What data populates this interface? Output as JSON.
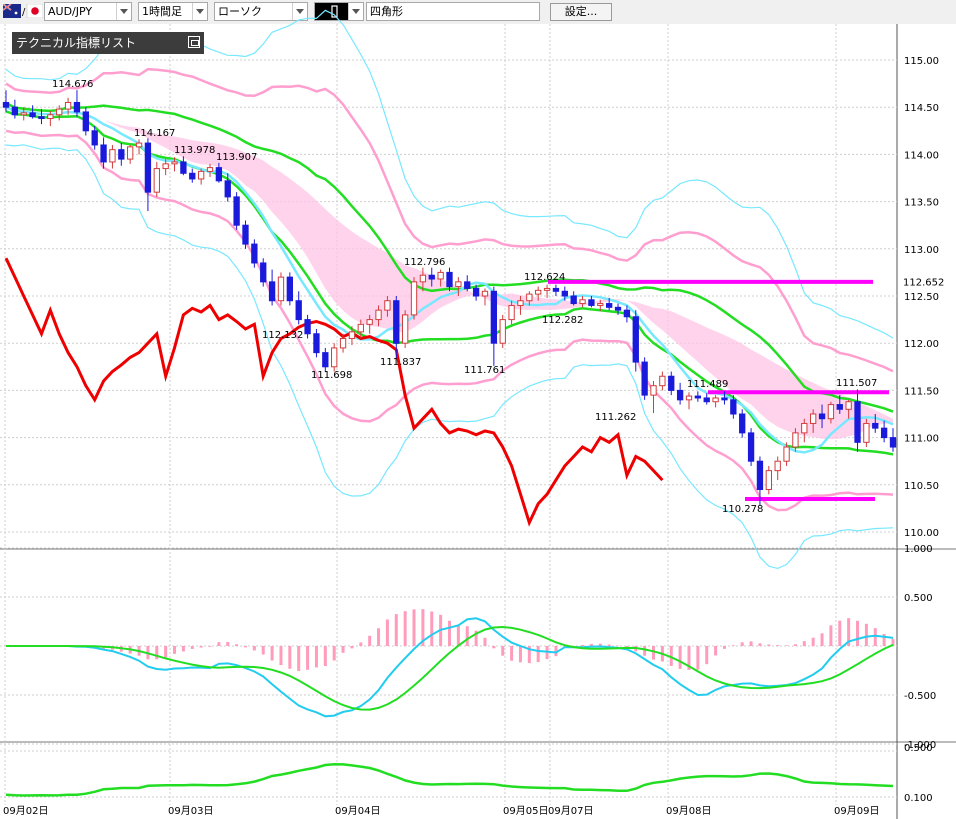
{
  "toolbar": {
    "pair": "AUD/JPY",
    "timeframe": "1時間足",
    "chart_style": "ローソク",
    "draw_tool": "四角形",
    "settings_label": "設定..."
  },
  "indicator_panel": {
    "title": "テクニカル指標リスト"
  },
  "colors": {
    "bull": "#d23c3c",
    "bear": "#1a1adc",
    "lagging_span": "#ee0000",
    "sma_fast": "#22dd22",
    "sma_band": "#ff9fd0",
    "bb_outer": "#77e8ff",
    "macd": "#22ccee",
    "signal": "#22dd22",
    "histogram": "#ff9bbb",
    "hline": "#ff00ff",
    "cloud": "#ffc4e6"
  },
  "main_axis": {
    "ticks": [
      "115.00",
      "114.50",
      "114.00",
      "113.50",
      "113.00",
      "112.50",
      "112.00",
      "111.50",
      "111.00",
      "110.50",
      "110.00"
    ],
    "current_price": "112.652"
  },
  "macd_axis": {
    "ticks": [
      "1.000",
      "0.500",
      "-0.500",
      "-1.000"
    ]
  },
  "sub_axis": {
    "ticks": [
      "0.500",
      "0.100"
    ]
  },
  "x_labels": [
    "09月02日",
    "09月03日",
    "09月04日",
    "09月05日",
    "09月07日",
    "09月08日",
    "09月09日"
  ],
  "chart_data": {
    "type": "candlestick",
    "price_labels": [
      "114.676",
      "114.167",
      "113.978",
      "113.907",
      "112.132",
      "111.698",
      "112.796",
      "111.837",
      "111.761",
      "112.624",
      "112.282",
      "111.262",
      "111.489",
      "110.278",
      "111.507"
    ],
    "horizontal_lines": [
      112.65,
      111.48,
      110.35
    ],
    "ylim": [
      110.0,
      115.0
    ],
    "candles": [
      [
        114.55,
        114.68,
        114.45,
        114.5
      ],
      [
        114.5,
        114.58,
        114.38,
        114.42
      ],
      [
        114.42,
        114.5,
        114.36,
        114.44
      ],
      [
        114.44,
        114.52,
        114.38,
        114.4
      ],
      [
        114.4,
        114.48,
        114.32,
        114.38
      ],
      [
        114.38,
        114.46,
        114.3,
        114.42
      ],
      [
        114.42,
        114.52,
        114.36,
        114.48
      ],
      [
        114.48,
        114.6,
        114.42,
        114.55
      ],
      [
        114.55,
        114.68,
        114.4,
        114.45
      ],
      [
        114.45,
        114.5,
        114.2,
        114.25
      ],
      [
        114.25,
        114.3,
        114.05,
        114.1
      ],
      [
        114.1,
        114.18,
        113.85,
        113.92
      ],
      [
        113.92,
        114.1,
        113.85,
        114.05
      ],
      [
        114.05,
        114.12,
        113.88,
        113.95
      ],
      [
        113.95,
        114.1,
        113.9,
        114.08
      ],
      [
        114.08,
        114.16,
        114.0,
        114.12
      ],
      [
        114.12,
        114.17,
        113.4,
        113.6
      ],
      [
        113.6,
        113.92,
        113.55,
        113.85
      ],
      [
        113.85,
        113.95,
        113.78,
        113.9
      ],
      [
        113.9,
        113.97,
        113.82,
        113.92
      ],
      [
        113.92,
        113.98,
        113.78,
        113.8
      ],
      [
        113.8,
        113.85,
        113.7,
        113.74
      ],
      [
        113.74,
        113.85,
        113.68,
        113.82
      ],
      [
        113.82,
        113.9,
        113.76,
        113.86
      ],
      [
        113.86,
        113.91,
        113.7,
        113.72
      ],
      [
        113.72,
        113.8,
        113.5,
        113.55
      ],
      [
        113.55,
        113.6,
        113.2,
        113.25
      ],
      [
        113.25,
        113.3,
        113.0,
        113.05
      ],
      [
        113.05,
        113.1,
        112.8,
        112.85
      ],
      [
        112.85,
        112.9,
        112.6,
        112.65
      ],
      [
        112.65,
        112.78,
        112.4,
        112.45
      ],
      [
        112.45,
        112.75,
        112.4,
        112.7
      ],
      [
        112.7,
        112.75,
        112.4,
        112.45
      ],
      [
        112.45,
        112.55,
        112.2,
        112.25
      ],
      [
        112.25,
        112.3,
        112.05,
        112.1
      ],
      [
        112.1,
        112.15,
        111.85,
        111.9
      ],
      [
        111.9,
        111.95,
        111.7,
        111.75
      ],
      [
        111.75,
        112.0,
        111.7,
        111.95
      ],
      [
        111.95,
        112.1,
        111.9,
        112.05
      ],
      [
        112.05,
        112.18,
        111.98,
        112.12
      ],
      [
        112.12,
        112.25,
        112.05,
        112.2
      ],
      [
        112.2,
        112.3,
        112.1,
        112.25
      ],
      [
        112.25,
        112.4,
        112.18,
        112.35
      ],
      [
        112.35,
        112.5,
        112.28,
        112.45
      ],
      [
        112.45,
        112.5,
        111.84,
        112.0
      ],
      [
        112.0,
        112.35,
        111.95,
        112.3
      ],
      [
        112.3,
        112.7,
        112.25,
        112.65
      ],
      [
        112.65,
        112.8,
        112.55,
        112.72
      ],
      [
        112.72,
        112.8,
        112.6,
        112.68
      ],
      [
        112.68,
        112.78,
        112.6,
        112.75
      ],
      [
        112.75,
        112.8,
        112.55,
        112.6
      ],
      [
        112.6,
        112.7,
        112.5,
        112.65
      ],
      [
        112.65,
        112.72,
        112.55,
        112.58
      ],
      [
        112.58,
        112.62,
        112.45,
        112.5
      ],
      [
        112.5,
        112.58,
        112.4,
        112.55
      ],
      [
        112.55,
        112.6,
        111.76,
        112.0
      ],
      [
        112.0,
        112.3,
        111.95,
        112.25
      ],
      [
        112.25,
        112.45,
        112.2,
        112.4
      ],
      [
        112.4,
        112.5,
        112.3,
        112.45
      ],
      [
        112.45,
        112.55,
        112.4,
        112.52
      ],
      [
        112.52,
        112.6,
        112.45,
        112.56
      ],
      [
        112.56,
        112.62,
        112.48,
        112.58
      ],
      [
        112.58,
        112.62,
        112.5,
        112.55
      ],
      [
        112.55,
        112.6,
        112.45,
        112.5
      ],
      [
        112.5,
        112.55,
        112.4,
        112.42
      ],
      [
        112.42,
        112.5,
        112.38,
        112.46
      ],
      [
        112.46,
        112.5,
        112.38,
        112.4
      ],
      [
        112.4,
        112.46,
        112.34,
        112.42
      ],
      [
        112.42,
        112.48,
        112.35,
        112.38
      ],
      [
        112.38,
        112.42,
        112.3,
        112.35
      ],
      [
        112.35,
        112.4,
        112.22,
        112.28
      ],
      [
        112.28,
        112.35,
        111.7,
        111.8
      ],
      [
        111.8,
        111.85,
        111.4,
        111.45
      ],
      [
        111.45,
        111.6,
        111.26,
        111.55
      ],
      [
        111.55,
        111.7,
        111.5,
        111.65
      ],
      [
        111.65,
        111.7,
        111.45,
        111.5
      ],
      [
        111.5,
        111.58,
        111.35,
        111.4
      ],
      [
        111.4,
        111.48,
        111.3,
        111.44
      ],
      [
        111.44,
        111.49,
        111.38,
        111.42
      ],
      [
        111.42,
        111.47,
        111.35,
        111.38
      ],
      [
        111.38,
        111.45,
        111.32,
        111.42
      ],
      [
        111.42,
        111.49,
        111.35,
        111.4
      ],
      [
        111.4,
        111.45,
        111.2,
        111.25
      ],
      [
        111.25,
        111.3,
        111.0,
        111.05
      ],
      [
        111.05,
        111.1,
        110.7,
        110.75
      ],
      [
        110.75,
        110.8,
        110.28,
        110.45
      ],
      [
        110.45,
        110.7,
        110.4,
        110.65
      ],
      [
        110.65,
        110.8,
        110.55,
        110.75
      ],
      [
        110.75,
        110.95,
        110.7,
        110.9
      ],
      [
        110.9,
        111.1,
        110.85,
        111.05
      ],
      [
        111.05,
        111.2,
        110.95,
        111.15
      ],
      [
        111.15,
        111.3,
        111.05,
        111.25
      ],
      [
        111.25,
        111.35,
        111.1,
        111.2
      ],
      [
        111.2,
        111.38,
        111.15,
        111.35
      ],
      [
        111.35,
        111.45,
        111.25,
        111.3
      ],
      [
        111.3,
        111.4,
        111.2,
        111.38
      ],
      [
        111.38,
        111.51,
        110.85,
        110.95
      ],
      [
        110.95,
        111.2,
        110.9,
        111.15
      ],
      [
        111.15,
        111.25,
        111.05,
        111.1
      ],
      [
        111.1,
        111.18,
        110.95,
        111.0
      ],
      [
        111.0,
        111.1,
        110.85,
        110.9
      ]
    ]
  }
}
